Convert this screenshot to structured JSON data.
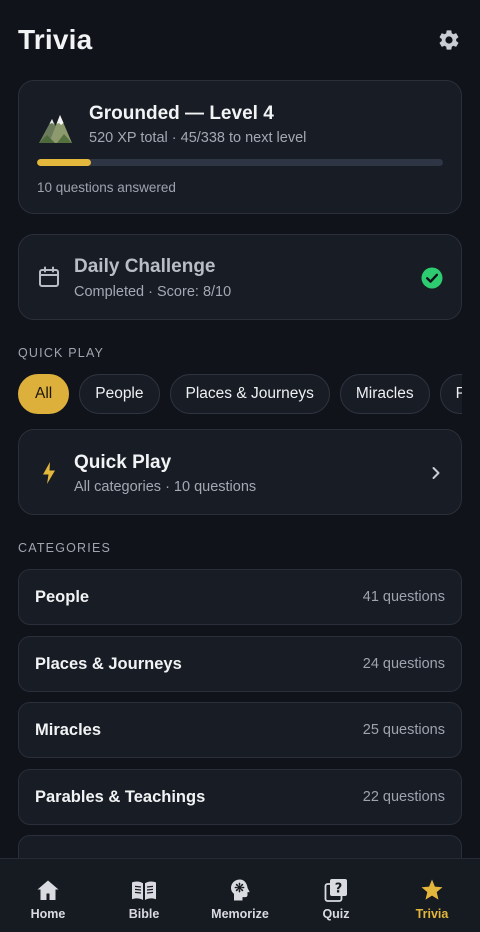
{
  "header": {
    "title": "Trivia"
  },
  "level": {
    "title": "Grounded — Level 4",
    "subtitle": "520 XP total · 45/338 to next level",
    "progress_fraction": 0.133,
    "answered": "10 questions answered"
  },
  "daily": {
    "title": "Daily Challenge",
    "subtitle": "Completed · Score: 8/10"
  },
  "quick_play_section": {
    "label": "QUICK PLAY",
    "chips": [
      "All",
      "People",
      "Places & Journeys",
      "Miracles",
      "Parables & Teachings"
    ]
  },
  "quick_play": {
    "title": "Quick Play",
    "subtitle": "All categories · 10 questions"
  },
  "categories_section": {
    "label": "CATEGORIES",
    "items": [
      {
        "name": "People",
        "count": "41 questions"
      },
      {
        "name": "Places & Journeys",
        "count": "24 questions"
      },
      {
        "name": "Miracles",
        "count": "25 questions"
      },
      {
        "name": "Parables & Teachings",
        "count": "22 questions"
      }
    ]
  },
  "tabs": [
    {
      "label": "Home",
      "icon": "home-icon"
    },
    {
      "label": "Bible",
      "icon": "book-icon"
    },
    {
      "label": "Memorize",
      "icon": "brain-icon"
    },
    {
      "label": "Quiz",
      "icon": "question-icon"
    },
    {
      "label": "Trivia",
      "icon": "star-icon"
    }
  ],
  "colors": {
    "accent": "#e2b73b",
    "success": "#2ecc71",
    "background": "#10131a",
    "card": "#181c24"
  }
}
